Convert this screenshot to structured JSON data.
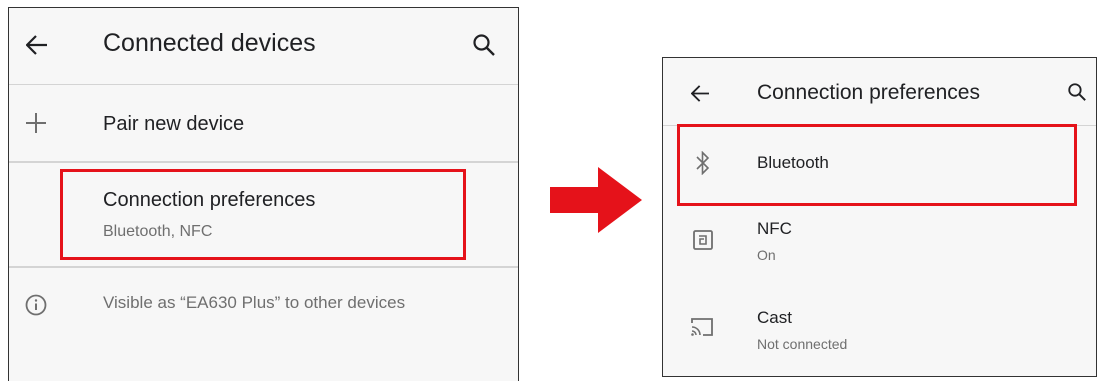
{
  "left_screen": {
    "title": "Connected devices",
    "back_icon": "arrow-left-icon",
    "search_icon": "search-icon",
    "pair_new_device": {
      "label": "Pair new device",
      "icon": "plus-icon"
    },
    "connection_preferences": {
      "label": "Connection preferences",
      "summary": "Bluetooth, NFC"
    },
    "visible_as": {
      "text": "Visible as “EA630 Plus” to other devices",
      "icon": "info-icon"
    }
  },
  "right_screen": {
    "title": "Connection preferences",
    "back_icon": "arrow-left-icon",
    "search_icon": "search-icon",
    "items": [
      {
        "label": "Bluetooth",
        "summary": "",
        "icon": "bluetooth-icon"
      },
      {
        "label": "NFC",
        "summary": "On",
        "icon": "nfc-icon"
      },
      {
        "label": "Cast",
        "summary": "Not connected",
        "icon": "cast-icon"
      }
    ]
  },
  "colors": {
    "highlight": "#e5121a",
    "arrow": "#e5121a",
    "panel_bg": "#f7f7f7",
    "divider": "#d4d4d4"
  }
}
